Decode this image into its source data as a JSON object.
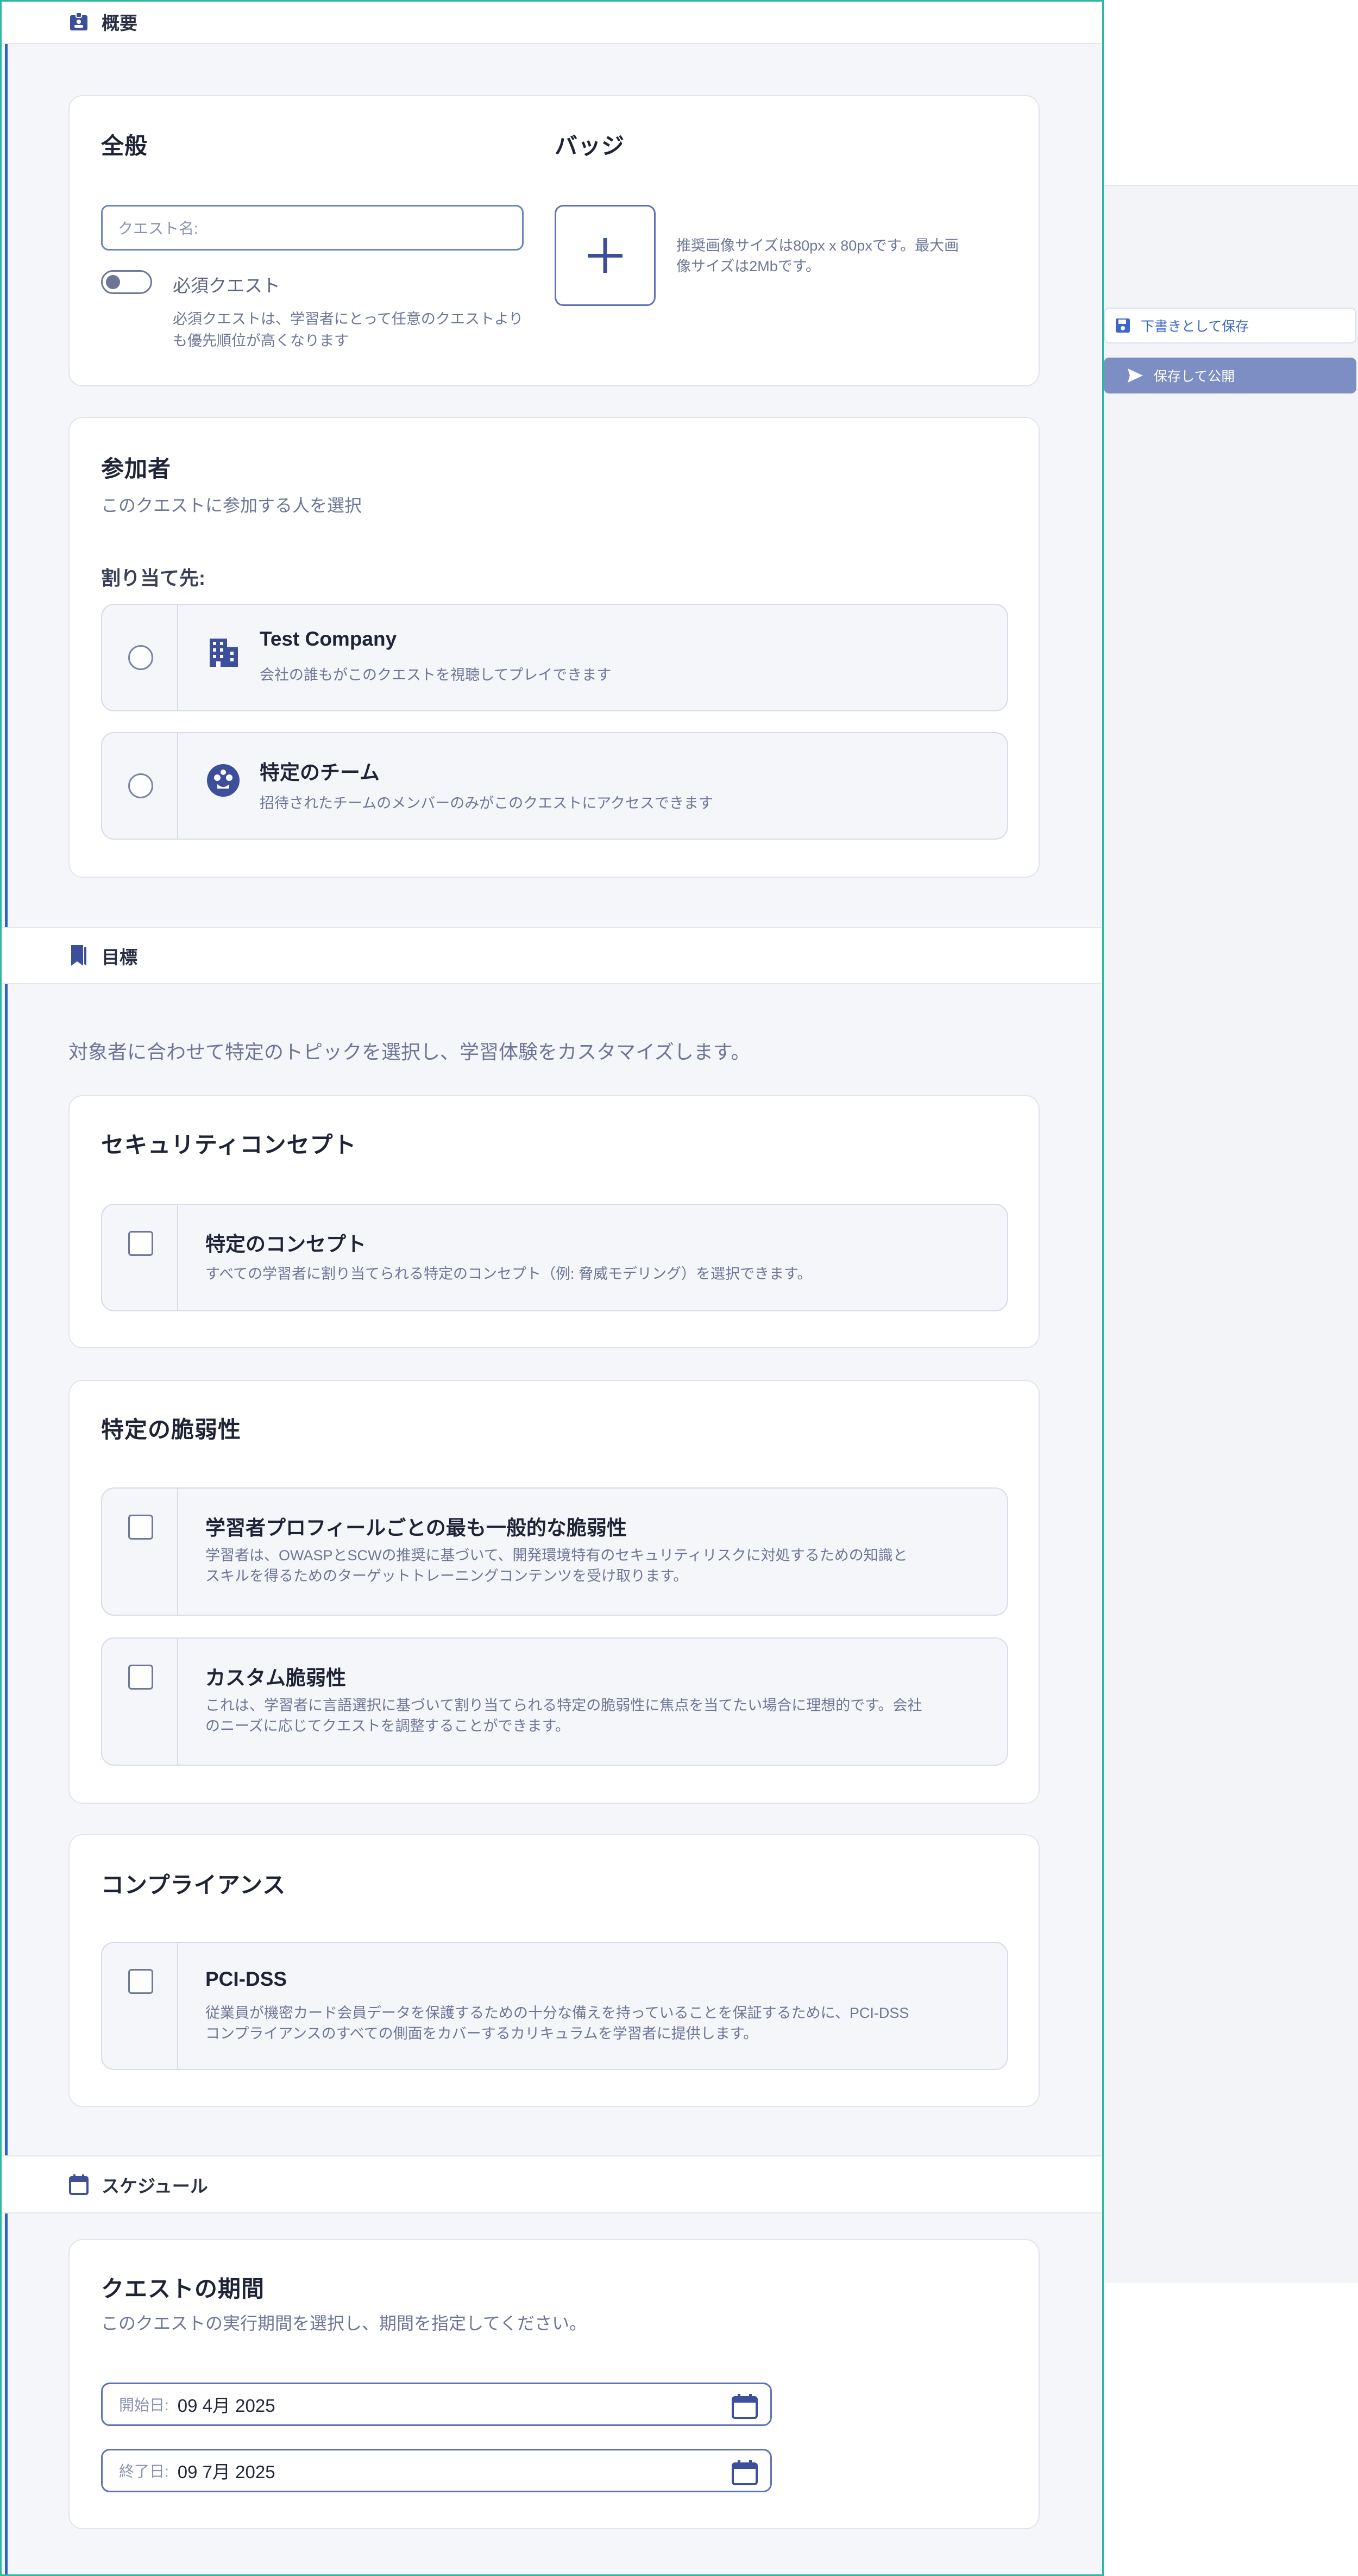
{
  "sections": {
    "overview": "概要",
    "goals": "目標",
    "schedule": "スケジュール"
  },
  "general": {
    "title": "全般",
    "quest_name_placeholder": "クエスト名:",
    "required_label": "必須クエスト",
    "required_desc_line1": "必須クエストは、学習者にとって任意のクエストより",
    "required_desc_line2": "も優先順位が高くなります"
  },
  "badge": {
    "title": "バッジ",
    "hint_line1": "推奨画像サイズは80px x 80pxです。最大画",
    "hint_line2": "像サイズは2Mbです。"
  },
  "participants": {
    "title": "参加者",
    "subtitle": "このクエストに参加する人を選択",
    "assign_label": "割り当て先:",
    "options": [
      {
        "title": "Test Company",
        "desc": "会社の誰もがこのクエストを視聴してプレイできます"
      },
      {
        "title": "特定のチーム",
        "desc": "招待されたチームのメンバーのみがこのクエストにアクセスできます"
      }
    ]
  },
  "goals": {
    "intro": "対象者に合わせて特定のトピックを選択し、学習体験をカスタマイズします。",
    "security_concepts": {
      "title": "セキュリティコンセプト",
      "options": [
        {
          "title": "特定のコンセプト",
          "desc": "すべての学習者に割り当てられる特定のコンセプト（例: 脅威モデリング）を選択できます。"
        }
      ]
    },
    "vulnerabilities": {
      "title": "特定の脆弱性",
      "options": [
        {
          "title": "学習者プロフィールごとの最も一般的な脆弱性",
          "desc1": "学習者は、OWASPとSCWの推奨に基づいて、開発環境特有のセキュリティリスクに対処するための知識と",
          "desc2": "スキルを得るためのターゲットトレーニングコンテンツを受け取ります。"
        },
        {
          "title": "カスタム脆弱性",
          "desc1": "これは、学習者に言語選択に基づいて割り当てられる特定の脆弱性に焦点を当てたい場合に理想的です。会社",
          "desc2": "のニーズに応じてクエストを調整することができます。"
        }
      ]
    },
    "compliance": {
      "title": "コンプライアンス",
      "options": [
        {
          "title": "PCI-DSS",
          "desc1": "従業員が機密カード会員データを保護するための十分な備えを持っていることを保証するために、PCI-DSS",
          "desc2": "コンプライアンスのすべての側面をカバーするカリキュラムを学習者に提供します。"
        }
      ]
    }
  },
  "schedule": {
    "title": "クエストの期間",
    "subtitle": "このクエストの実行期間を選択し、期間を指定してください。",
    "start_label": "開始日:",
    "start_value": "09 4月 2025",
    "end_label": "終了日:",
    "end_value": "09 7月 2025"
  },
  "actions": {
    "save_draft": "下書きとして保存",
    "save_publish": "保存して公開"
  },
  "colors": {
    "accent": "#2c61c9",
    "frame": "#2bb9a0",
    "publish_button": "#7d8ec5"
  }
}
